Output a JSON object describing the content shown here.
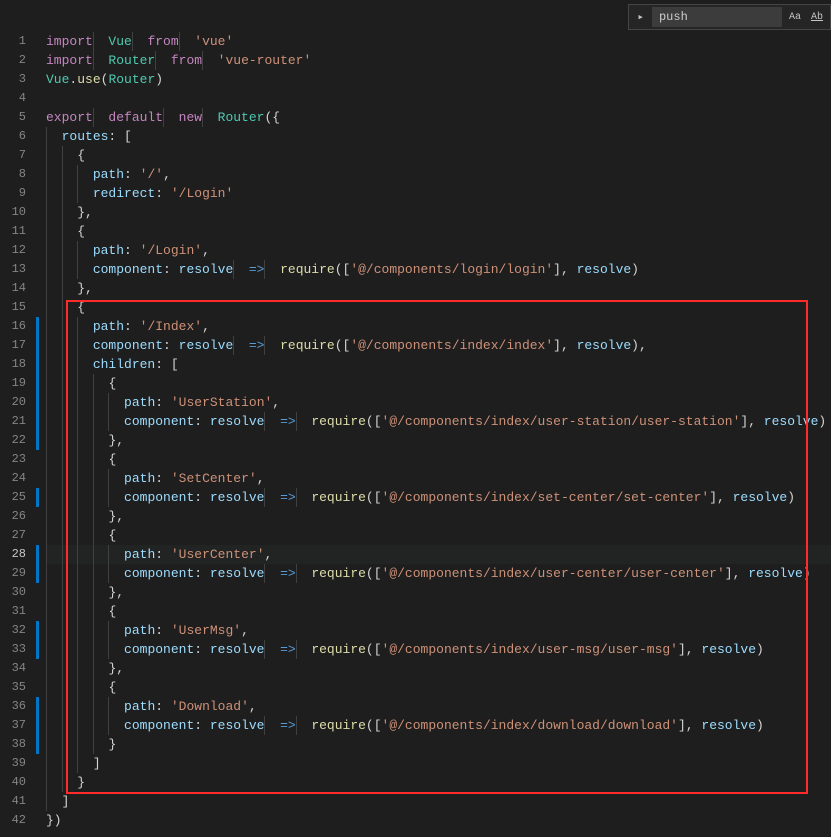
{
  "find": {
    "value": "push",
    "expand_glyph": "▸",
    "opt_case": "Aa",
    "opt_word": "Ab"
  },
  "gutter": {
    "count": 42,
    "active": 28
  },
  "change_bars": [
    16,
    17,
    18,
    19,
    20,
    21,
    22,
    25,
    28,
    29,
    32,
    33,
    36,
    37,
    38
  ],
  "code": [
    [
      [
        "kw",
        "import"
      ],
      [
        "punc",
        " "
      ],
      [
        "cls",
        "Vue"
      ],
      [
        "punc",
        " "
      ],
      [
        "kw",
        "from"
      ],
      [
        "punc",
        " "
      ],
      [
        "str",
        "'vue'"
      ]
    ],
    [
      [
        "kw",
        "import"
      ],
      [
        "punc",
        " "
      ],
      [
        "cls",
        "Router"
      ],
      [
        "punc",
        " "
      ],
      [
        "kw",
        "from"
      ],
      [
        "punc",
        " "
      ],
      [
        "str",
        "'vue-router'"
      ]
    ],
    [
      [
        "cls",
        "Vue"
      ],
      [
        "punc",
        "."
      ],
      [
        "func",
        "use"
      ],
      [
        "punc",
        "("
      ],
      [
        "cls",
        "Router"
      ],
      [
        "punc",
        ")"
      ]
    ],
    [],
    [
      [
        "kw",
        "export"
      ],
      [
        "punc",
        " "
      ],
      [
        "kw",
        "default"
      ],
      [
        "punc",
        " "
      ],
      [
        "kw",
        "new"
      ],
      [
        "punc",
        " "
      ],
      [
        "cls",
        "Router"
      ],
      [
        "punc",
        "({"
      ]
    ],
    [
      [
        "punc",
        "  "
      ],
      [
        "ident",
        "routes"
      ],
      [
        "punc",
        ": ["
      ]
    ],
    [
      [
        "punc",
        "    {"
      ]
    ],
    [
      [
        "punc",
        "      "
      ],
      [
        "ident",
        "path"
      ],
      [
        "punc",
        ": "
      ],
      [
        "str",
        "'/'"
      ],
      [
        "punc",
        ","
      ]
    ],
    [
      [
        "punc",
        "      "
      ],
      [
        "ident",
        "redirect"
      ],
      [
        "punc",
        ": "
      ],
      [
        "str",
        "'/Login'"
      ]
    ],
    [
      [
        "punc",
        "    },"
      ]
    ],
    [
      [
        "punc",
        "    {"
      ]
    ],
    [
      [
        "punc",
        "      "
      ],
      [
        "ident",
        "path"
      ],
      [
        "punc",
        ": "
      ],
      [
        "str",
        "'/Login'"
      ],
      [
        "punc",
        ","
      ]
    ],
    [
      [
        "punc",
        "      "
      ],
      [
        "ident",
        "component"
      ],
      [
        "punc",
        ": "
      ],
      [
        "ident",
        "resolve"
      ],
      [
        "punc",
        " "
      ],
      [
        "arrow",
        "=>"
      ],
      [
        "punc",
        " "
      ],
      [
        "func",
        "require"
      ],
      [
        "punc",
        "(["
      ],
      [
        "str",
        "'@/components/login/login'"
      ],
      [
        "punc",
        "], "
      ],
      [
        "ident",
        "resolve"
      ],
      [
        "punc",
        ")"
      ]
    ],
    [
      [
        "punc",
        "    },"
      ]
    ],
    [
      [
        "punc",
        "    {"
      ]
    ],
    [
      [
        "punc",
        "      "
      ],
      [
        "ident",
        "path"
      ],
      [
        "punc",
        ": "
      ],
      [
        "str",
        "'/Index'"
      ],
      [
        "punc",
        ","
      ]
    ],
    [
      [
        "punc",
        "      "
      ],
      [
        "ident",
        "component"
      ],
      [
        "punc",
        ": "
      ],
      [
        "ident",
        "resolve"
      ],
      [
        "punc",
        " "
      ],
      [
        "arrow",
        "=>"
      ],
      [
        "punc",
        " "
      ],
      [
        "func",
        "require"
      ],
      [
        "punc",
        "(["
      ],
      [
        "str",
        "'@/components/index/index'"
      ],
      [
        "punc",
        "], "
      ],
      [
        "ident",
        "resolve"
      ],
      [
        "punc",
        "),"
      ]
    ],
    [
      [
        "punc",
        "      "
      ],
      [
        "ident",
        "children"
      ],
      [
        "punc",
        ": ["
      ]
    ],
    [
      [
        "punc",
        "        {"
      ]
    ],
    [
      [
        "punc",
        "          "
      ],
      [
        "ident",
        "path"
      ],
      [
        "punc",
        ": "
      ],
      [
        "str",
        "'UserStation'"
      ],
      [
        "punc",
        ","
      ]
    ],
    [
      [
        "punc",
        "          "
      ],
      [
        "ident",
        "component"
      ],
      [
        "punc",
        ": "
      ],
      [
        "ident",
        "resolve"
      ],
      [
        "punc",
        " "
      ],
      [
        "arrow",
        "=>"
      ],
      [
        "punc",
        " "
      ],
      [
        "func",
        "require"
      ],
      [
        "punc",
        "(["
      ],
      [
        "str",
        "'@/components/index/user-station/user-station'"
      ],
      [
        "punc",
        "], "
      ],
      [
        "ident",
        "resolve"
      ],
      [
        "punc",
        ")"
      ]
    ],
    [
      [
        "punc",
        "        },"
      ]
    ],
    [
      [
        "punc",
        "        {"
      ]
    ],
    [
      [
        "punc",
        "          "
      ],
      [
        "ident",
        "path"
      ],
      [
        "punc",
        ": "
      ],
      [
        "str",
        "'SetCenter'"
      ],
      [
        "punc",
        ","
      ]
    ],
    [
      [
        "punc",
        "          "
      ],
      [
        "ident",
        "component"
      ],
      [
        "punc",
        ": "
      ],
      [
        "ident",
        "resolve"
      ],
      [
        "punc",
        " "
      ],
      [
        "arrow",
        "=>"
      ],
      [
        "punc",
        " "
      ],
      [
        "func",
        "require"
      ],
      [
        "punc",
        "(["
      ],
      [
        "str",
        "'@/components/index/set-center/set-center'"
      ],
      [
        "punc",
        "], "
      ],
      [
        "ident",
        "resolve"
      ],
      [
        "punc",
        ")"
      ]
    ],
    [
      [
        "punc",
        "        },"
      ]
    ],
    [
      [
        "punc",
        "        {"
      ]
    ],
    [
      [
        "punc",
        "          "
      ],
      [
        "ident",
        "path"
      ],
      [
        "punc",
        ": "
      ],
      [
        "str",
        "'UserCenter'"
      ],
      [
        "punc",
        ","
      ]
    ],
    [
      [
        "punc",
        "          "
      ],
      [
        "ident",
        "component"
      ],
      [
        "punc",
        ": "
      ],
      [
        "ident",
        "resolve"
      ],
      [
        "punc",
        " "
      ],
      [
        "arrow",
        "=>"
      ],
      [
        "punc",
        " "
      ],
      [
        "func",
        "require"
      ],
      [
        "punc",
        "(["
      ],
      [
        "str",
        "'@/components/index/user-center/user-center'"
      ],
      [
        "punc",
        "], "
      ],
      [
        "ident",
        "resolve"
      ],
      [
        "punc",
        ")"
      ]
    ],
    [
      [
        "punc",
        "        },"
      ]
    ],
    [
      [
        "punc",
        "        {"
      ]
    ],
    [
      [
        "punc",
        "          "
      ],
      [
        "ident",
        "path"
      ],
      [
        "punc",
        ": "
      ],
      [
        "str",
        "'UserMsg'"
      ],
      [
        "punc",
        ","
      ]
    ],
    [
      [
        "punc",
        "          "
      ],
      [
        "ident",
        "component"
      ],
      [
        "punc",
        ": "
      ],
      [
        "ident",
        "resolve"
      ],
      [
        "punc",
        " "
      ],
      [
        "arrow",
        "=>"
      ],
      [
        "punc",
        " "
      ],
      [
        "func",
        "require"
      ],
      [
        "punc",
        "(["
      ],
      [
        "str",
        "'@/components/index/user-msg/user-msg'"
      ],
      [
        "punc",
        "], "
      ],
      [
        "ident",
        "resolve"
      ],
      [
        "punc",
        ")"
      ]
    ],
    [
      [
        "punc",
        "        },"
      ]
    ],
    [
      [
        "punc",
        "        {"
      ]
    ],
    [
      [
        "punc",
        "          "
      ],
      [
        "ident",
        "path"
      ],
      [
        "punc",
        ": "
      ],
      [
        "str",
        "'Download'"
      ],
      [
        "punc",
        ","
      ]
    ],
    [
      [
        "punc",
        "          "
      ],
      [
        "ident",
        "component"
      ],
      [
        "punc",
        ": "
      ],
      [
        "ident",
        "resolve"
      ],
      [
        "punc",
        " "
      ],
      [
        "arrow",
        "=>"
      ],
      [
        "punc",
        " "
      ],
      [
        "func",
        "require"
      ],
      [
        "punc",
        "(["
      ],
      [
        "str",
        "'@/components/index/download/download'"
      ],
      [
        "punc",
        "], "
      ],
      [
        "ident",
        "resolve"
      ],
      [
        "punc",
        ")"
      ]
    ],
    [
      [
        "punc",
        "        }"
      ]
    ],
    [
      [
        "punc",
        "      ]"
      ]
    ],
    [
      [
        "punc",
        "    }"
      ]
    ],
    [
      [
        "punc",
        "  ]"
      ]
    ],
    [
      [
        "punc",
        "})"
      ]
    ]
  ]
}
